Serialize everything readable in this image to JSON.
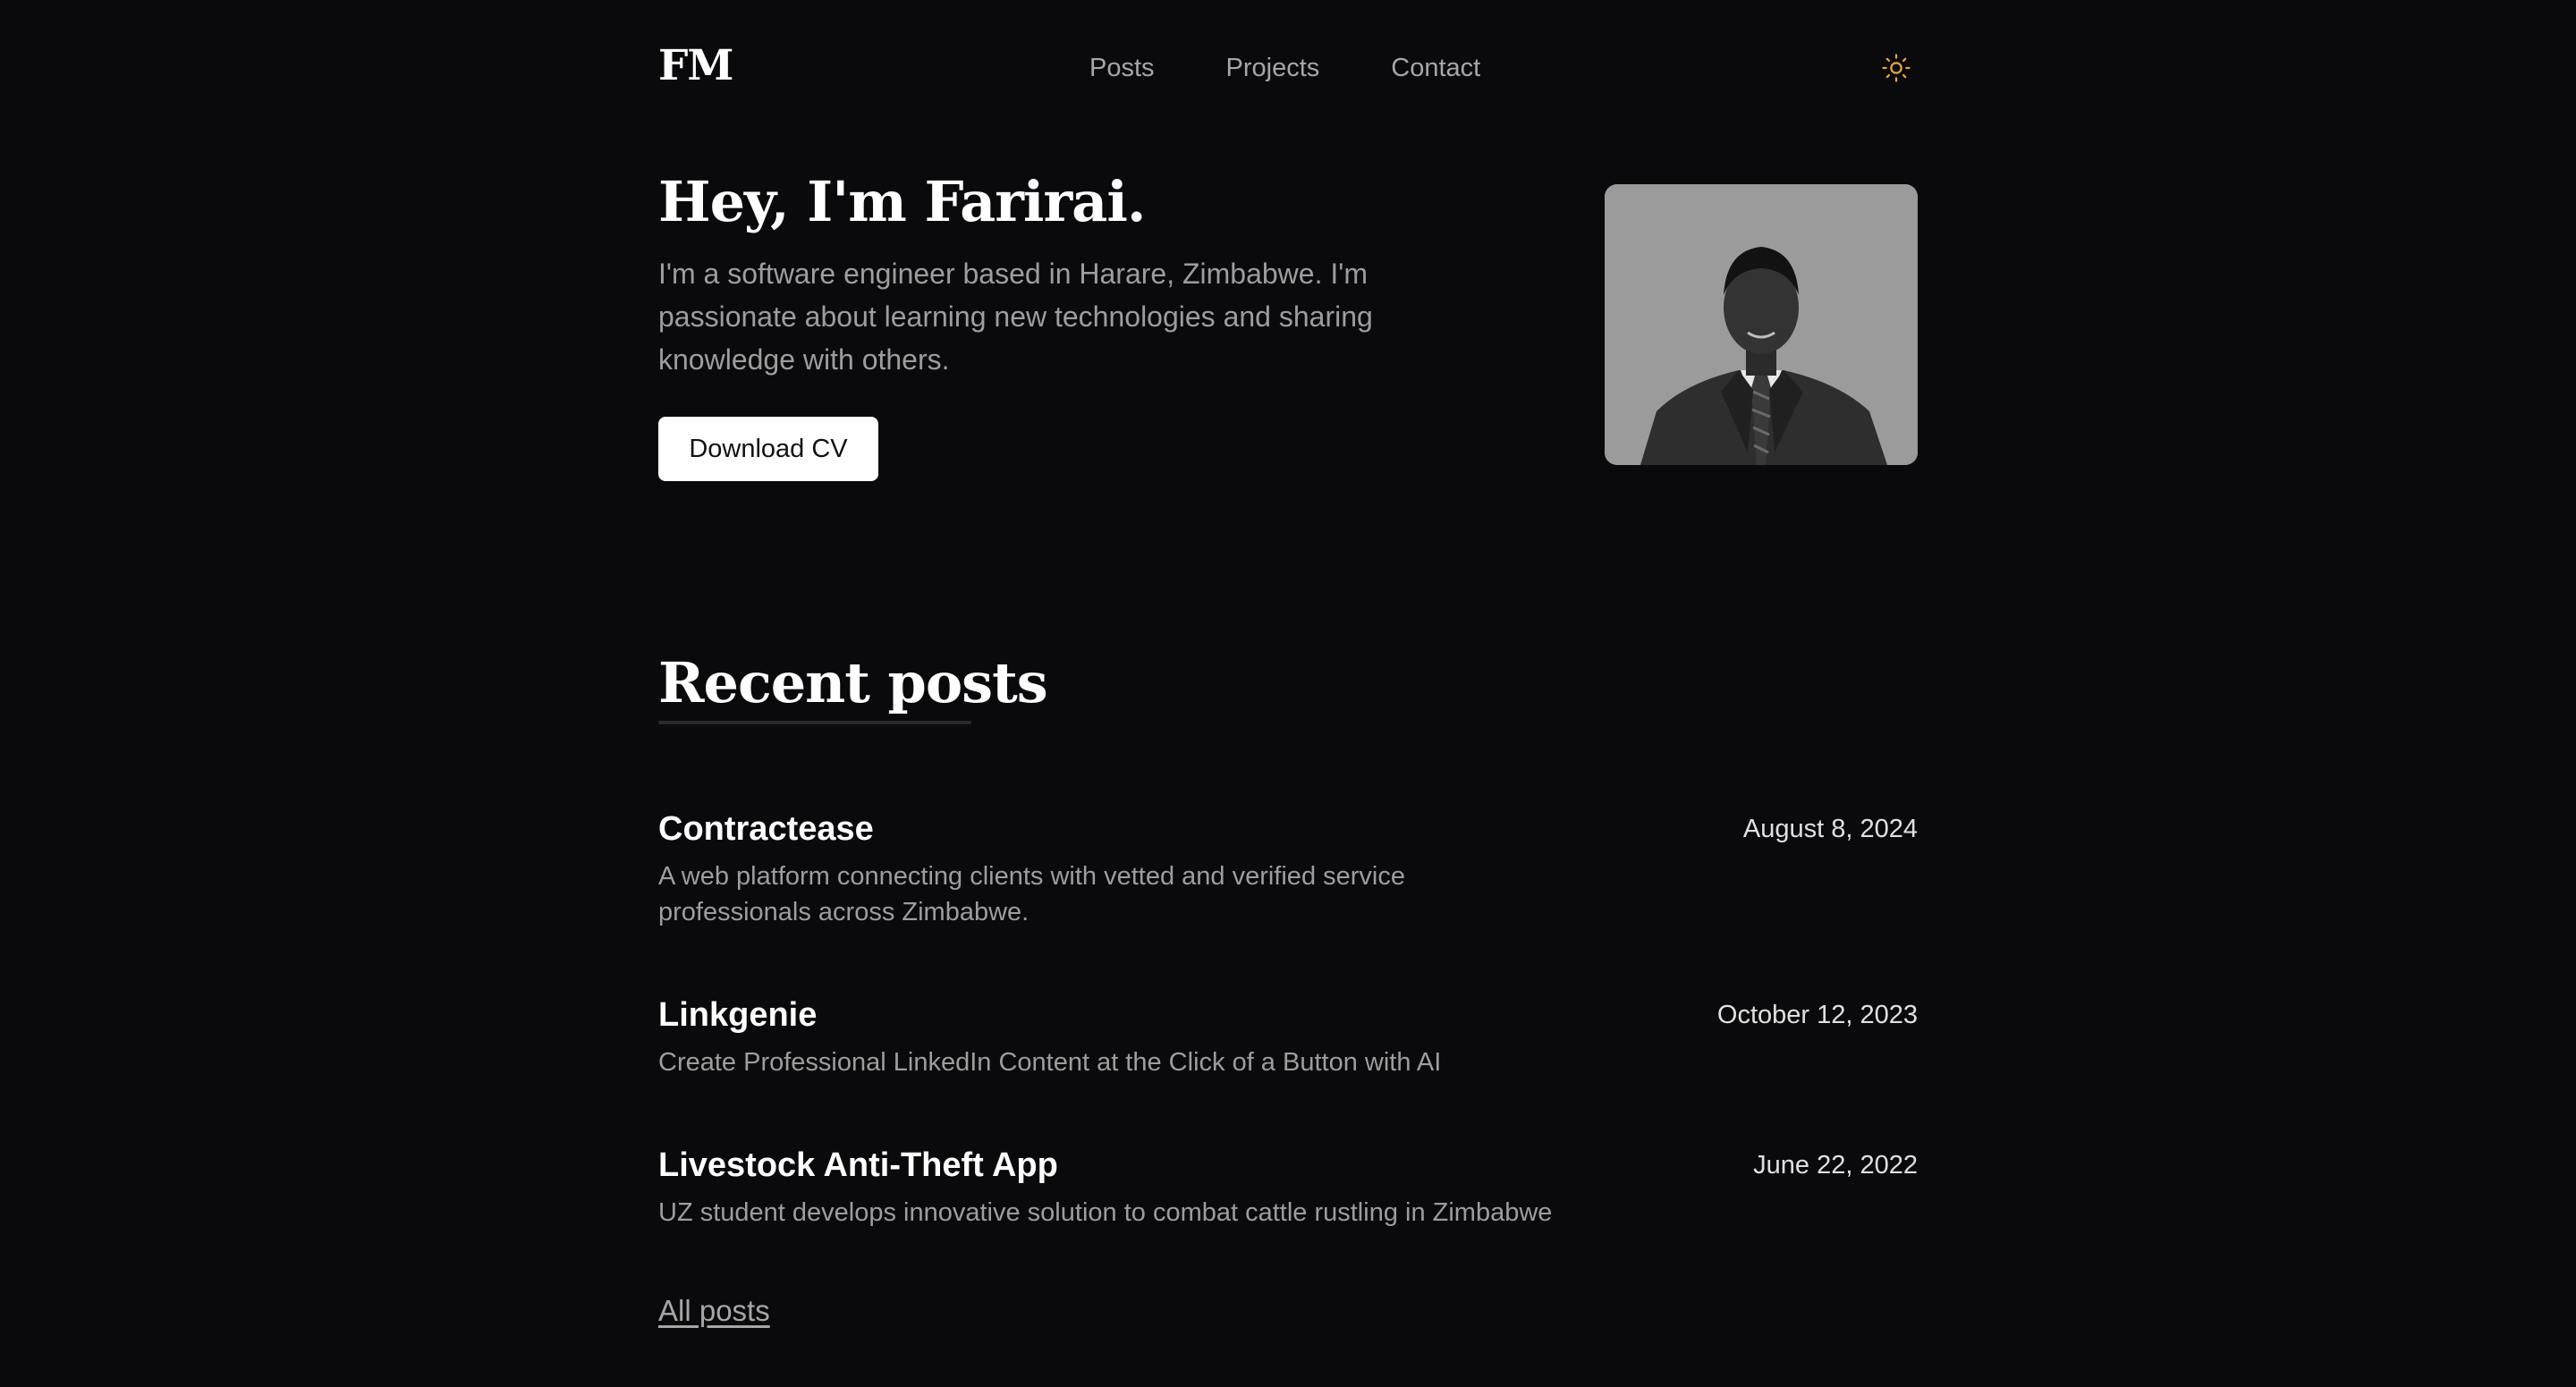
{
  "header": {
    "logo": "FM",
    "nav": [
      "Posts",
      "Projects",
      "Contact"
    ],
    "theme_icon": "sun-icon",
    "accent_color": "#e8a24a"
  },
  "hero": {
    "title": "Hey, I'm Farirai.",
    "description": "I'm a software engineer based in Harare, Zimbabwe. I'm passionate about learning new technologies and sharing knowledge with others.",
    "cv_button": "Download CV"
  },
  "recent_posts": {
    "title": "Recent posts",
    "posts": [
      {
        "title": "Contractease",
        "date": "August 8, 2024",
        "description": "A web platform connecting clients with vetted and verified service professionals across Zimbabwe."
      },
      {
        "title": "Linkgenie",
        "date": "October 12, 2023",
        "description": "Create Professional LinkedIn Content at the Click of a Button with AI"
      },
      {
        "title": "Livestock Anti-Theft App",
        "date": "June 22, 2022",
        "description": "UZ student develops innovative solution to combat cattle rustling in Zimbabwe"
      }
    ],
    "all_posts_link": "All posts"
  }
}
